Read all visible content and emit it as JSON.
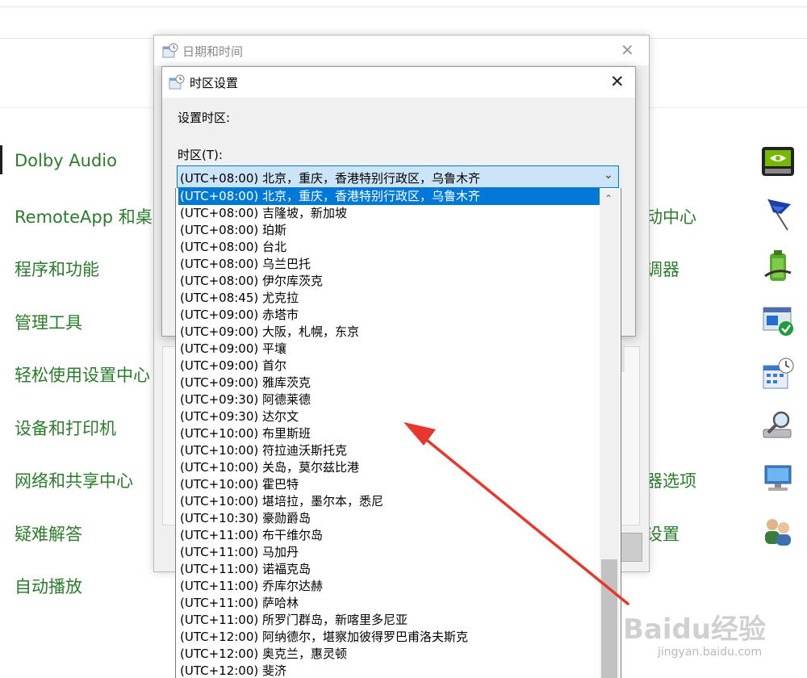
{
  "control_panel": {
    "left_items": [
      {
        "label": "Dolby Audio"
      },
      {
        "label": "RemoteApp 和桌面"
      },
      {
        "label": "程序和功能"
      },
      {
        "label": "管理工具"
      },
      {
        "label": "轻松使用设置中心"
      },
      {
        "label": "设备和打印机"
      },
      {
        "label": "网络和共享中心"
      },
      {
        "label": "疑难解答"
      },
      {
        "label": "自动播放"
      }
    ],
    "right_items": [
      {
        "label": "动中心"
      },
      {
        "label": "调器"
      },
      {
        "label": "器选项"
      },
      {
        "label": "设置"
      }
    ],
    "icons": [
      "nvidia-control-panel-icon",
      "flag-icon",
      "battery-power-icon",
      "defender-check-icon",
      "calendar-clock-icon",
      "indexing-search-icon",
      "remote-desktop-icon",
      "user-accounts-icon"
    ]
  },
  "outer_dialog": {
    "title": "日期和时间",
    "close": "✕"
  },
  "inner_dialog": {
    "title": "时区设置",
    "close": "✕",
    "set_label": "设置时区:",
    "tz_label": "时区(T):",
    "selected": "(UTC+08:00) 北京，重庆，香港特别行政区，乌鲁木齐",
    "arrow": "⌄"
  },
  "timezones": [
    "(UTC+08:00) 北京，重庆，香港特别行政区，乌鲁木齐",
    "(UTC+08:00) 吉隆坡，新加坡",
    "(UTC+08:00) 珀斯",
    "(UTC+08:00) 台北",
    "(UTC+08:00) 乌兰巴托",
    "(UTC+08:00) 伊尔库茨克",
    "(UTC+08:45) 尤克拉",
    "(UTC+09:00) 赤塔市",
    "(UTC+09:00) 大阪，札幌，东京",
    "(UTC+09:00) 平壤",
    "(UTC+09:00) 首尔",
    "(UTC+09:00) 雅库茨克",
    "(UTC+09:30) 阿德莱德",
    "(UTC+09:30) 达尔文",
    "(UTC+10:00) 布里斯班",
    "(UTC+10:00) 符拉迪沃斯托克",
    "(UTC+10:00) 关岛，莫尔兹比港",
    "(UTC+10:00) 霍巴特",
    "(UTC+10:00) 堪培拉，墨尔本，悉尼",
    "(UTC+10:30) 豪勋爵岛",
    "(UTC+11:00) 布干维尔岛",
    "(UTC+11:00) 马加丹",
    "(UTC+11:00) 诺福克岛",
    "(UTC+11:00) 乔库尔达赫",
    "(UTC+11:00) 萨哈林",
    "(UTC+11:00) 所罗门群岛，新喀里多尼亚",
    "(UTC+12:00) 阿纳德尔，堪察加彼得罗巴甫洛夫斯克",
    "(UTC+12:00) 奥克兰，惠灵顿",
    "(UTC+12:00) 斐济"
  ],
  "scrollbar": {
    "up": "⌃"
  },
  "watermark": {
    "brand": "Baidu经验",
    "url": "jingyan.baidu.com"
  },
  "colors": {
    "selection": "#0078d7",
    "link_green": "#2a7d2a",
    "arrow_red": "#e8372c"
  }
}
